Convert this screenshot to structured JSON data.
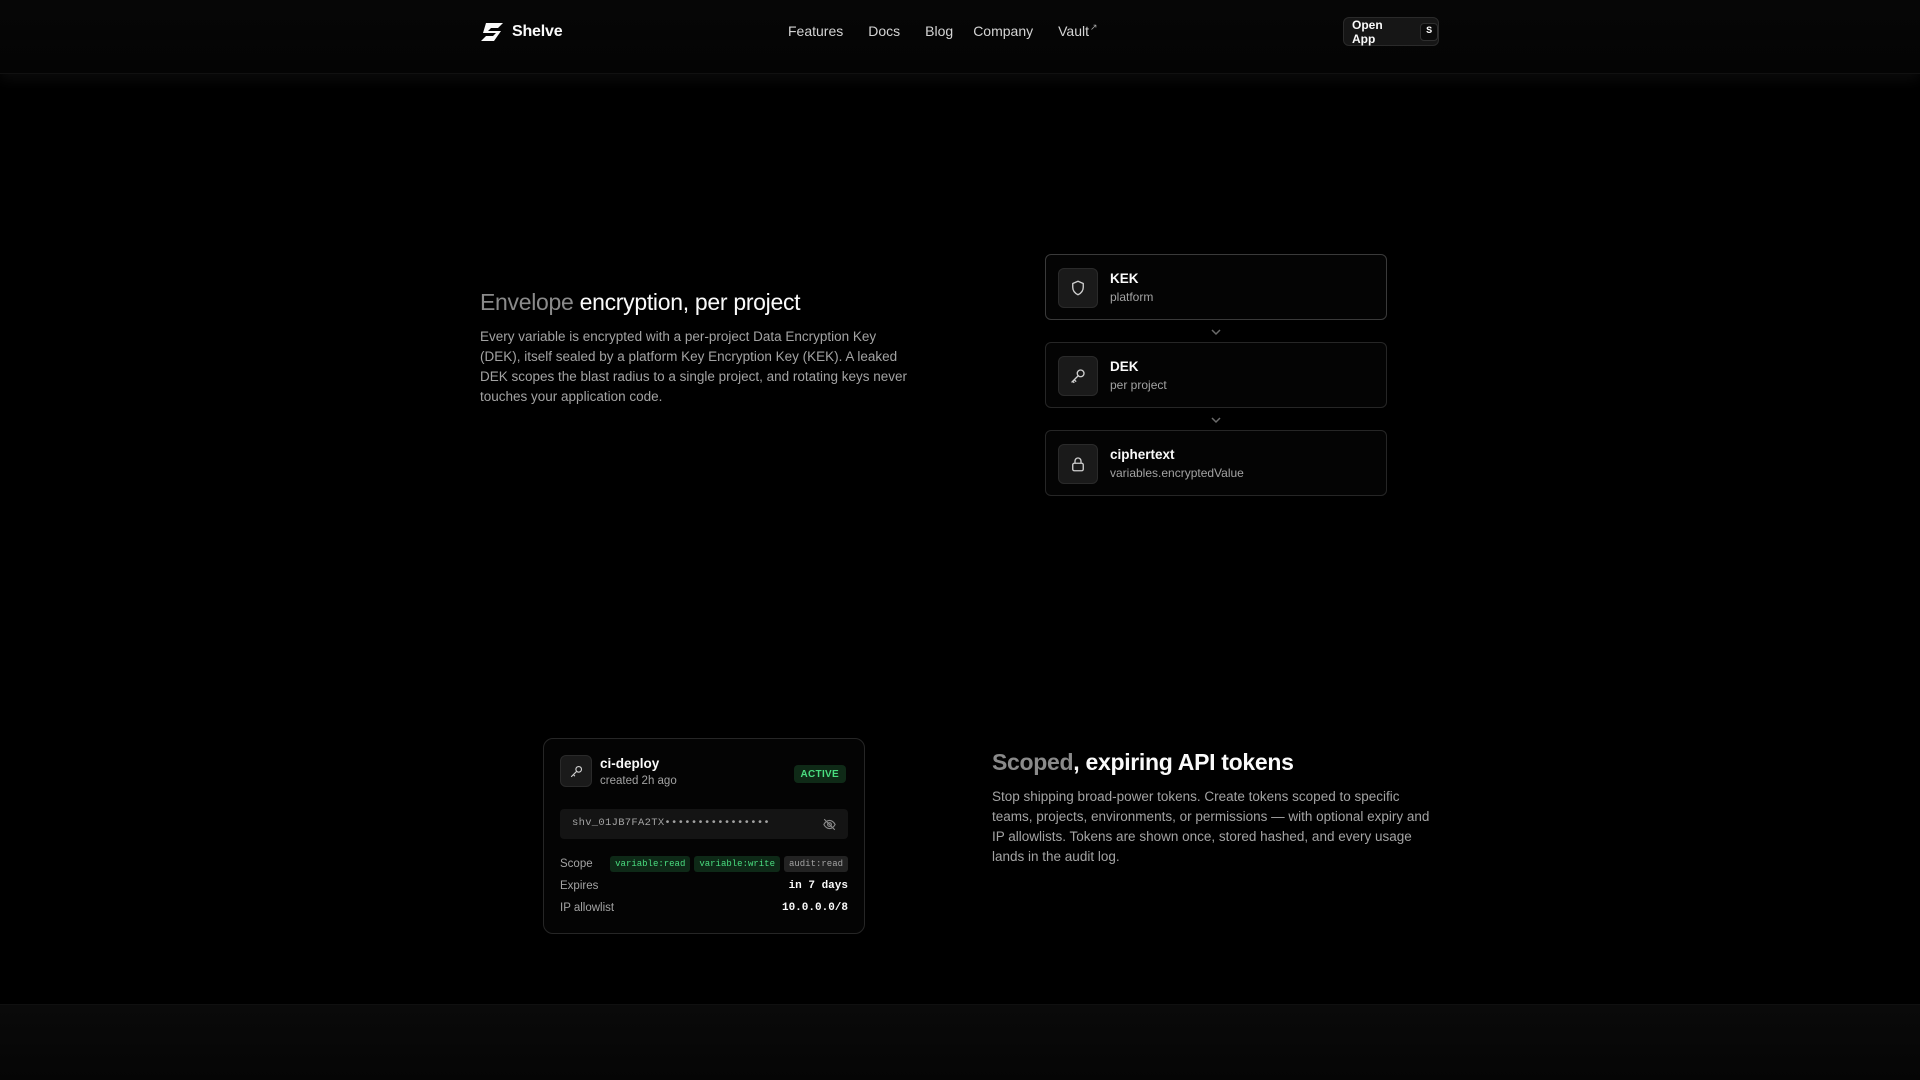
{
  "header": {
    "brand": "Shelve",
    "nav": [
      {
        "label": "Features"
      },
      {
        "label": "Docs"
      },
      {
        "label": "Blog"
      },
      {
        "label": "Company"
      },
      {
        "label": "Vault",
        "external": true
      }
    ],
    "cta": {
      "label": "Open App",
      "shortcut": "S"
    }
  },
  "envelope": {
    "title_muted": "Envelope",
    "title_rest": " encryption, per project",
    "description": "Every variable is encrypted with a per-project Data Encryption Key (DEK), itself sealed by a platform Key Encryption Key (KEK). A leaked DEK scopes the blast radius to a single project, and rotating keys never touches your application code.",
    "chain": [
      {
        "name": "KEK",
        "sub": "platform",
        "icon": "shield-icon"
      },
      {
        "name": "DEK",
        "sub": "per project",
        "icon": "key-icon"
      },
      {
        "name": "ciphertext",
        "sub": "variables.encryptedValue",
        "icon": "lock-icon"
      }
    ]
  },
  "token": {
    "name": "ci-deploy",
    "created": "created 2h ago",
    "status": "ACTIVE",
    "secret": "shv_01JB7FA2TX••••••••••••••••",
    "scope_label": "Scope",
    "scopes": [
      {
        "label": "variable:read",
        "style": "green"
      },
      {
        "label": "variable:write",
        "style": "green"
      },
      {
        "label": "audit:read",
        "style": "gray"
      }
    ],
    "expires_label": "Expires",
    "expires_value": "in 7 days",
    "ip_label": "IP allowlist",
    "ip_value": "10.0.0.0/8"
  },
  "tokens_section": {
    "title_muted": "Scoped",
    "title_rest": ", expiring API tokens",
    "description": "Stop shipping broad-power tokens. Create tokens scoped to specific teams, projects, environments, or permissions — with optional expiry and IP allowlists. Tokens are shown once, stored hashed, and every usage lands in the audit log."
  },
  "colors": {
    "background": "#000000",
    "text": "#fafafa",
    "muted": "#a3a3a3",
    "active_green": "#4ade80"
  }
}
